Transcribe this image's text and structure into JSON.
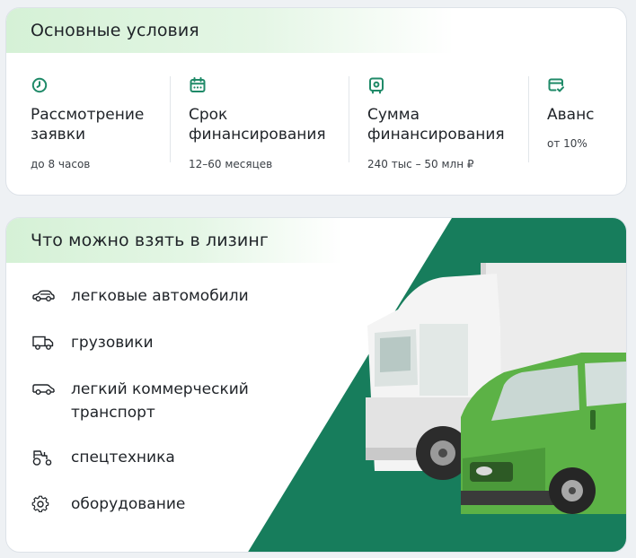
{
  "conditions": {
    "title": "Основные условия",
    "items": [
      {
        "icon": "clock-icon",
        "title_line1": "Рассмотрение",
        "title_line2": "заявки",
        "subtitle": "до 8 часов"
      },
      {
        "icon": "calendar-icon",
        "title_line1": "Срок",
        "title_line2": "финансирования",
        "subtitle": "12–60 месяцев"
      },
      {
        "icon": "safe-icon",
        "title_line1": "Сумма",
        "title_line2": "финансирования",
        "subtitle": "240 тыс – 50 млн ₽"
      },
      {
        "icon": "card-check-icon",
        "title_line1": "Аванс",
        "title_line2": "",
        "subtitle": "от 10%"
      }
    ]
  },
  "leasing": {
    "title": "Что можно взять в лизинг",
    "items": [
      {
        "icon": "car-icon",
        "line1": "легковые автомобили",
        "line2": ""
      },
      {
        "icon": "truck-icon",
        "line1": "грузовики",
        "line2": ""
      },
      {
        "icon": "van-icon",
        "line1": "легкий коммерческий",
        "line2": "транспорт"
      },
      {
        "icon": "tractor-icon",
        "line1": "спецтехника",
        "line2": ""
      },
      {
        "icon": "gear-icon",
        "line1": "оборудование",
        "line2": ""
      }
    ]
  },
  "colors": {
    "accent": "#1f8a68",
    "header_tint": "#d5f1d6",
    "illustration_bg": "#177d5c",
    "van": "#5cb246"
  }
}
